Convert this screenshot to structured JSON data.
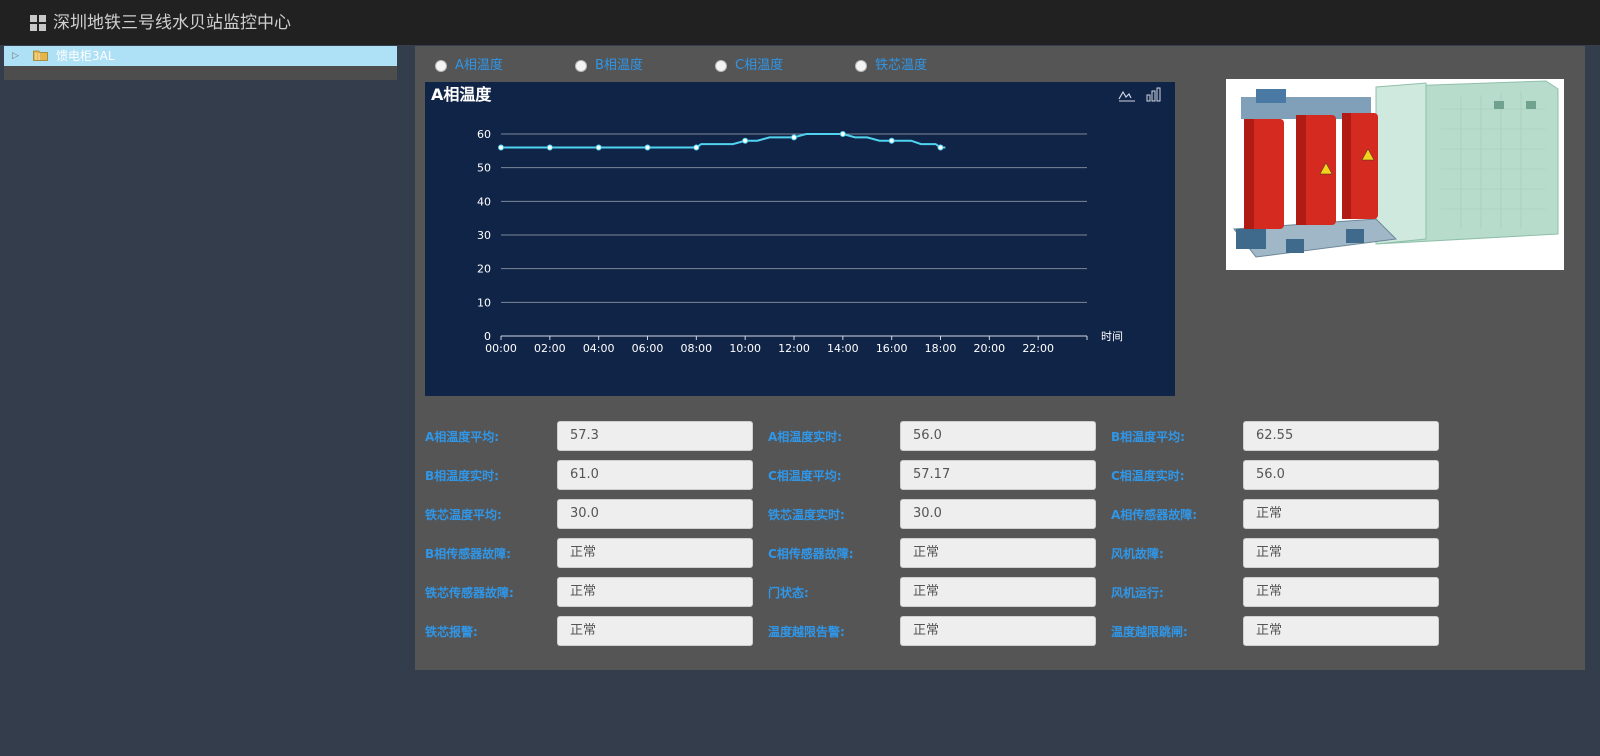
{
  "header": {
    "title": "深圳地铁三号线水贝站监控中心",
    "icon": "grid-icon"
  },
  "tree": {
    "items": [
      {
        "label": "馈电柜3AL",
        "icon": "folder-icon",
        "expand_icon": "triangle-right-icon"
      }
    ]
  },
  "radios": [
    {
      "label": "A相温度"
    },
    {
      "label": "B相温度"
    },
    {
      "label": "C相温度"
    },
    {
      "label": "铁芯温度"
    }
  ],
  "photo": {
    "icon": "transformer-icon"
  },
  "chart_data": {
    "type": "line",
    "title": "A相温度",
    "xlabel": "时间",
    "ylabel": "",
    "x_ticks": [
      "00:00",
      "02:00",
      "04:00",
      "06:00",
      "08:00",
      "10:00",
      "12:00",
      "14:00",
      "16:00",
      "18:00",
      "20:00",
      "22:00"
    ],
    "y_ticks": [
      0,
      10,
      20,
      30,
      40,
      50,
      60
    ],
    "ylim": [
      0,
      60
    ],
    "xlim_hours": [
      0,
      24
    ],
    "grid": true,
    "line_color": "#4fd3f0",
    "series": [
      {
        "values": [
          {
            "t": 0,
            "v": 56
          },
          {
            "t": 2,
            "v": 56
          },
          {
            "t": 4,
            "v": 56
          },
          {
            "t": 6,
            "v": 56
          },
          {
            "t": 8,
            "v": 56
          },
          {
            "t": 8.2,
            "v": 57
          },
          {
            "t": 9.5,
            "v": 57
          },
          {
            "t": 10,
            "v": 58
          },
          {
            "t": 10.5,
            "v": 58
          },
          {
            "t": 11,
            "v": 59
          },
          {
            "t": 12,
            "v": 59
          },
          {
            "t": 12.5,
            "v": 60
          },
          {
            "t": 13.5,
            "v": 60
          },
          {
            "t": 14,
            "v": 60
          },
          {
            "t": 14.5,
            "v": 59
          },
          {
            "t": 15,
            "v": 59
          },
          {
            "t": 15.5,
            "v": 58
          },
          {
            "t": 16,
            "v": 58
          },
          {
            "t": 16.8,
            "v": 58
          },
          {
            "t": 17.2,
            "v": 57
          },
          {
            "t": 17.8,
            "v": 57
          },
          {
            "t": 18,
            "v": 56
          },
          {
            "t": 18.2,
            "v": 56
          }
        ],
        "markers": [
          0,
          2,
          4,
          6,
          8,
          10,
          12,
          14,
          16,
          18
        ]
      }
    ],
    "toolbox": [
      "line-chart-icon",
      "bar-chart-icon"
    ]
  },
  "fields": [
    {
      "label": "A相温度平均:",
      "value": "57.3"
    },
    {
      "label": "A相温度实时:",
      "value": "56.0"
    },
    {
      "label": "B相温度平均:",
      "value": "62.55"
    },
    {
      "label": "B相温度实时:",
      "value": "61.0"
    },
    {
      "label": "C相温度平均:",
      "value": "57.17"
    },
    {
      "label": "C相温度实时:",
      "value": "56.0"
    },
    {
      "label": "铁芯温度平均:",
      "value": "30.0"
    },
    {
      "label": "铁芯温度实时:",
      "value": "30.0"
    },
    {
      "label": "A相传感器故障:",
      "value": "正常"
    },
    {
      "label": "B相传感器故障:",
      "value": "正常"
    },
    {
      "label": "C相传感器故障:",
      "value": "正常"
    },
    {
      "label": "风机故障:",
      "value": "正常"
    },
    {
      "label": "铁芯传感器故障:",
      "value": "正常"
    },
    {
      "label": "门状态:",
      "value": "正常"
    },
    {
      "label": "风机运行:",
      "value": "正常"
    },
    {
      "label": "铁芯报警:",
      "value": "正常"
    },
    {
      "label": "温度越限告警:",
      "value": "正常"
    },
    {
      "label": "温度越限跳闸:",
      "value": "正常"
    }
  ]
}
